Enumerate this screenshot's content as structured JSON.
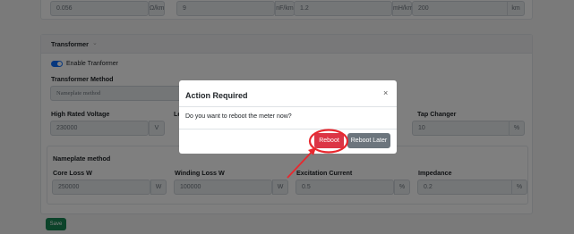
{
  "top_row": {
    "fields": [
      {
        "value": "0.056",
        "unit": "Ω/km"
      },
      {
        "value": "9",
        "unit": "nF/km"
      },
      {
        "value": "1.2",
        "unit": "mH/km"
      },
      {
        "value": "200",
        "unit": "km"
      }
    ]
  },
  "transformer": {
    "header": "Transformer",
    "enable_label": "Enable Tranformer",
    "method_label": "Transformer Method",
    "method_value": "Nameplate method",
    "high_voltage_label": "High Rated Voltage",
    "high_voltage_value": "230000",
    "high_voltage_unit": "V",
    "low_voltage_label_partial": "Lo",
    "tap_changer_label": "Tap Changer",
    "tap_changer_value": "10",
    "tap_changer_unit": "%",
    "nameplate": {
      "title": "Nameplate method",
      "core_loss_label": "Core Loss W",
      "core_loss_value": "250000",
      "core_loss_unit": "W",
      "winding_loss_label": "Winding Loss W",
      "winding_loss_value": "100000",
      "winding_loss_unit": "W",
      "excitation_label": "Excitation Current",
      "excitation_value": "0.5",
      "excitation_unit": "%",
      "impedance_label": "Impedance",
      "impedance_value": "0.2",
      "impedance_unit": "%"
    }
  },
  "save_label": "Save",
  "modal": {
    "title": "Action Required",
    "close_glyph": "×",
    "body": "Do you want to reboot the meter now?",
    "reboot_label": "Reboot",
    "reboot_later_label": "Reboot Later"
  },
  "colors": {
    "primary": "#0d6efd",
    "danger": "#dc3545",
    "secondary": "#6c757d",
    "success": "#198754",
    "annotation": "#e8282e"
  }
}
